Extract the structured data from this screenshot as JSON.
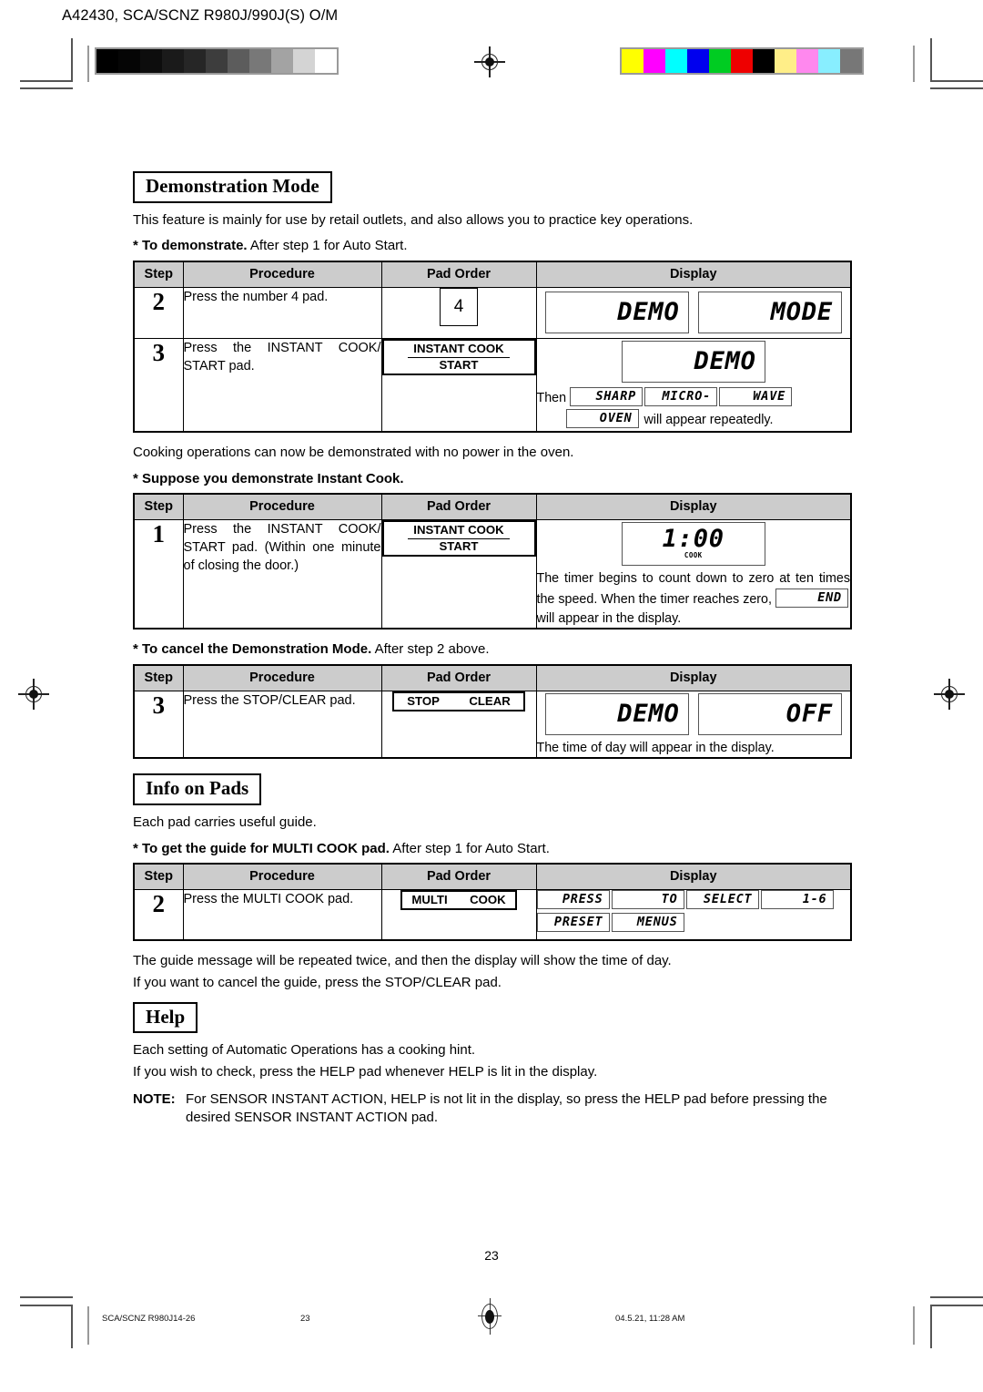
{
  "header": {
    "doc_code": "A42430, SCA/SCNZ R980J/990J(S) O/M"
  },
  "calibration": {
    "grayscale_label": "grayscale-bar",
    "grayscale_swatches": [
      "#000000",
      "#050505",
      "#0d0d0d",
      "#1a1a1a",
      "#262626",
      "#3d3d3d",
      "#5c5c5c",
      "#787878",
      "#a3a3a3",
      "#d4d4d4",
      "#ffffff"
    ],
    "color_label": "color-bar",
    "color_swatches": [
      "#ffff00",
      "#ff00ff",
      "#00ffff",
      "#0000ee",
      "#00cc22",
      "#ee0000",
      "#000000",
      "#ffee88",
      "#ff88ee",
      "#88eeff",
      "#777777"
    ]
  },
  "sections": [
    {
      "title": "Demonstration Mode",
      "intro": "This feature is mainly for use by retail outlets, and also allows you to practice key operations."
    },
    {
      "title": "Info on Pads",
      "intro": "Each pad carries useful guide."
    },
    {
      "title": "Help"
    }
  ],
  "star1": {
    "bold": "* To demonstrate.",
    "rest": " After step 1 for Auto Start."
  },
  "star2": {
    "bold": "* Suppose you demonstrate Instant Cook.",
    "rest": ""
  },
  "star3": {
    "bold": "* To cancel the Demonstration Mode.",
    "rest": " After step 2 above."
  },
  "star4": {
    "bold": "* To get the guide for MULTI COOK pad.",
    "rest": " After step 1 for Auto Start."
  },
  "table_headers": {
    "step": "Step",
    "procedure": "Procedure",
    "pad_order": "Pad Order",
    "display": "Display"
  },
  "table1": {
    "rows": [
      {
        "step": "2",
        "procedure": "Press the number 4 pad.",
        "pad": {
          "type": "number",
          "label": "4"
        },
        "display": {
          "lcd_left": "DEMO",
          "lcd_right": "MODE"
        }
      },
      {
        "step": "3",
        "procedure": "Press the INSTANT COOK/ START pad.",
        "pad": {
          "type": "two-line",
          "line1": "INSTANT COOK",
          "line2": "START"
        },
        "display": {
          "lcd_main": "DEMO",
          "then_label": "Then",
          "then_lcds": [
            "SHARP",
            "MICRO-",
            "WAVE",
            "OVEN"
          ],
          "then_tail": " will appear repeatedly."
        }
      }
    ]
  },
  "between_tables_note": "Cooking operations can now be demonstrated with no power in the oven.",
  "table2": {
    "rows": [
      {
        "step": "1",
        "procedure": "Press the INSTANT COOK/ START pad. (Within one minute of closing the door.)",
        "pad": {
          "type": "two-line",
          "line1": "INSTANT COOK",
          "line2": "START"
        },
        "display": {
          "timer_value": "1:00",
          "timer_sub": "COOK",
          "note_part1": "The timer begins to count down to zero at ten times the speed. When the timer reaches zero,",
          "note_lcd": "END",
          "note_part2": "will appear in the display."
        }
      }
    ]
  },
  "table3": {
    "rows": [
      {
        "step": "3",
        "procedure": "Press the STOP/CLEAR pad.",
        "pad": {
          "type": "two-line",
          "line1": "STOP",
          "line2": "CLEAR"
        },
        "display": {
          "lcd_left": "DEMO",
          "lcd_right": "OFF",
          "note": "The time of day will appear in the display."
        }
      }
    ]
  },
  "table4": {
    "rows": [
      {
        "step": "2",
        "procedure": "Press the MULTI COOK pad.",
        "pad": {
          "type": "two-line-block",
          "line1": "MULTI",
          "line2": "COOK"
        },
        "display": {
          "row1": [
            "PRESS",
            "TO",
            "SELECT",
            "1-6"
          ],
          "row2": [
            "PRESET",
            "MENUS"
          ]
        }
      }
    ]
  },
  "info_tail": {
    "line1": "The guide message will be repeated twice, and then the display will show the time of day.",
    "line2": "If you want to cancel the guide, press the STOP/CLEAR pad."
  },
  "help": {
    "line1": "Each setting of Automatic Operations has a cooking hint.",
    "line2": "If you wish to check, press the HELP pad whenever HELP is lit in the display.",
    "note_label": "NOTE:",
    "note_text": "For SENSOR INSTANT ACTION, HELP is not lit in the display, so press the HELP pad before pressing the desired SENSOR INSTANT ACTION pad."
  },
  "footer": {
    "page_number": "23",
    "left": "SCA/SCNZ R980J14-26",
    "center": "23",
    "right": "04.5.21, 11:28 AM"
  }
}
